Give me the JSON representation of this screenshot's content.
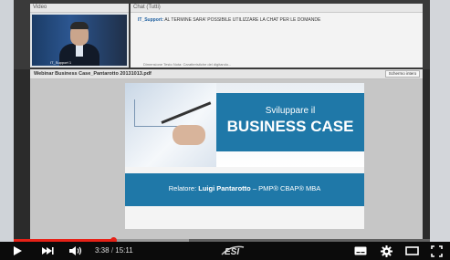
{
  "webinar": {
    "video_header": "Video",
    "video_label": "IT_Support 1",
    "chat_header": "Chat (Tutti)",
    "chat_sender": "IT_Support:",
    "chat_message": "AL TERMINE SARA' POSSIBILE UTILIZZARE LA CHAT PER LE DOMANDE",
    "chat_footer": "Dimensione Testo Nota: Caratteristiche del digitando...",
    "document_title": "Webinar Business Case_Pantarotto 20131013.pdf",
    "fullscreen_label": "Schermo intero"
  },
  "slide": {
    "heading_line1": "Sviluppare il",
    "heading_line2": "BUSINESS CASE",
    "speaker_prefix": "Relatore:",
    "speaker_name": "Luigi Pantarotto",
    "speaker_credentials": "– PMP® CBAP® MBA"
  },
  "player": {
    "current_time": "3:38",
    "time_separator": "/",
    "duration": "15:11",
    "progress_played": 0.24,
    "progress_buffered": 0.42,
    "logo_text": "ESI",
    "colors": {
      "progress": "#e62117",
      "slide_blue": "#1f78a8",
      "controls_bg": "#0b0b0b"
    },
    "icons": [
      "play-icon",
      "next-icon",
      "volume-icon",
      "subtitles-icon",
      "settings-gear-icon",
      "theater-mode-icon",
      "fullscreen-icon"
    ]
  }
}
